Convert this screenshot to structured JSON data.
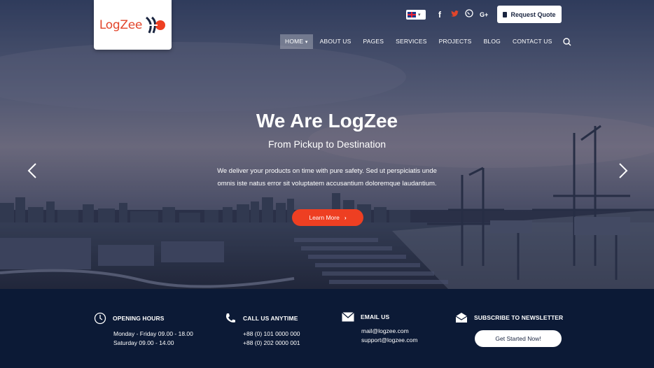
{
  "brand": {
    "name": "LogZee",
    "accent": "#ee3f22",
    "navy": "#0c1a36"
  },
  "topbar": {
    "language_flag": "uk-flag-icon",
    "socials": [
      {
        "name": "facebook-icon",
        "glyph": "f"
      },
      {
        "name": "twitter-icon",
        "glyph": "🐦"
      },
      {
        "name": "whatsapp-icon",
        "glyph": "◎"
      },
      {
        "name": "google-plus-icon",
        "glyph": "G+"
      }
    ],
    "quote_label": "Request Quote"
  },
  "nav": {
    "items": [
      "HOME",
      "ABOUT US",
      "PAGES",
      "SERVICES",
      "PROJECTS",
      "BLOG",
      "CONTACT US"
    ],
    "active_index": 0
  },
  "hero": {
    "title": "We Are LogZee",
    "subtitle": "From Pickup to Destination",
    "desc_line1": "We deliver your products on time with pure safety. Sed ut perspiciatis unde",
    "desc_line2": "omnis iste natus error sit voluptatem accusantium doloremque laudantium.",
    "cta_label": "Learn More"
  },
  "footer": {
    "hours": {
      "title": "OPENING HOURS",
      "line1": "Monday - Friday 09.00 - 18.00",
      "line2": "Saturday 09.00 - 14.00"
    },
    "call": {
      "title": "CALL US ANYTIME",
      "line1": "+88 (0) 101 0000 000",
      "line2": "+88 (0) 202 0000 001"
    },
    "email": {
      "title": "EMAIL US",
      "line1": "mail@logzee.com",
      "line2": "support@logzee.com"
    },
    "newsletter": {
      "title": "SUBSCRIBE TO NEWSLETTER",
      "button_label": "Get Started Now!"
    }
  }
}
